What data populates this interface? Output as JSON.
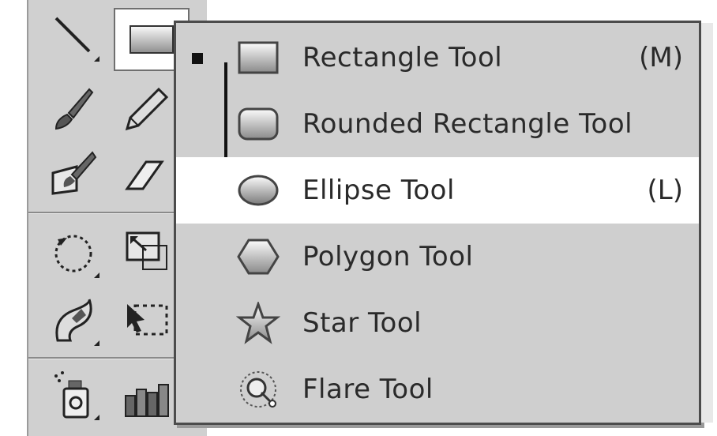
{
  "toolbar": {
    "tools": [
      {
        "name": "line-segment-tool-icon"
      },
      {
        "name": "rectangle-tool-icon",
        "selected": true
      },
      {
        "name": "paintbrush-tool-icon"
      },
      {
        "name": "pencil-tool-icon"
      },
      {
        "name": "blob-brush-tool-icon"
      },
      {
        "name": "eraser-tool-icon"
      },
      {
        "name": "rotate-tool-icon"
      },
      {
        "name": "scale-tool-icon"
      },
      {
        "name": "warp-tool-icon"
      },
      {
        "name": "free-transform-tool-icon"
      },
      {
        "name": "symbol-sprayer-tool-icon"
      },
      {
        "name": "column-graph-tool-icon"
      }
    ]
  },
  "flyout": {
    "items": [
      {
        "label": "Rectangle Tool",
        "shortcut": "(M)",
        "icon": "rectangle-icon"
      },
      {
        "label": "Rounded Rectangle Tool",
        "shortcut": "",
        "icon": "rounded-rectangle-icon"
      },
      {
        "label": "Ellipse Tool",
        "shortcut": "(L)",
        "icon": "ellipse-icon",
        "highlighted": true
      },
      {
        "label": "Polygon Tool",
        "shortcut": "",
        "icon": "polygon-icon"
      },
      {
        "label": "Star Tool",
        "shortcut": "",
        "icon": "star-icon"
      },
      {
        "label": "Flare Tool",
        "shortcut": "",
        "icon": "flare-icon"
      }
    ]
  }
}
